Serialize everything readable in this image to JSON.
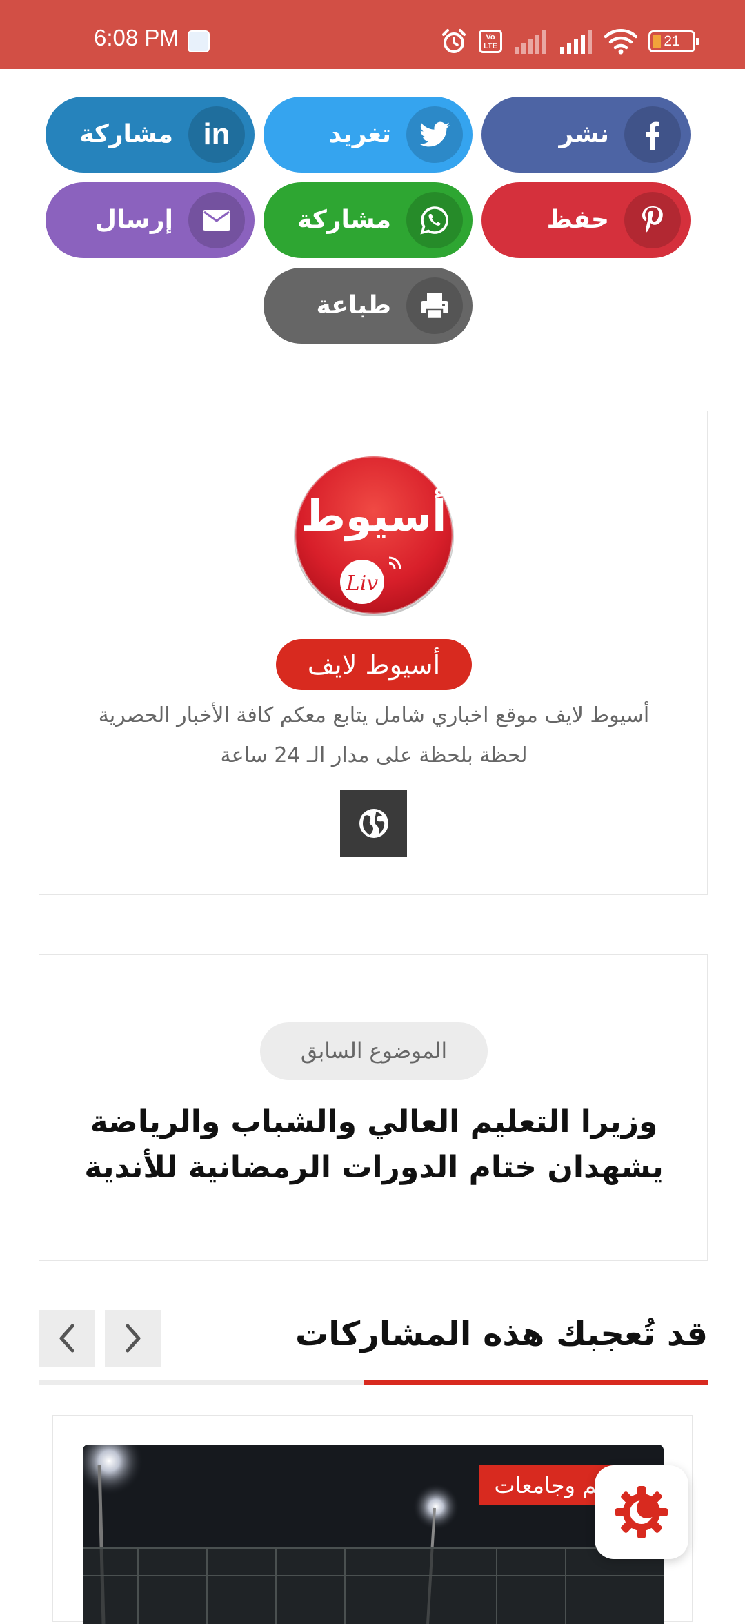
{
  "status_bar": {
    "time": "6:08 PM",
    "volte_label": "Vo LTE",
    "battery": "21"
  },
  "share": {
    "facebook": {
      "label": "نشر",
      "color": "#4d64a4"
    },
    "twitter": {
      "label": "تغريد",
      "color": "#35a4ef"
    },
    "linkedin": {
      "label": "مشاركة",
      "color": "#2683bc"
    },
    "pinterest": {
      "label": "حفظ",
      "color": "#d5303c"
    },
    "whatsapp": {
      "label": "مشاركة",
      "color": "#2ea632"
    },
    "email": {
      "label": "إرسال",
      "color": "#8b62be"
    },
    "print": {
      "label": "طباعة",
      "color": "#666666"
    }
  },
  "author": {
    "logo_text": "أسيوط",
    "logo_sub": "Liv",
    "name": "أسيوط لايف",
    "description": "أسيوط لايف موقع اخباري شامل يتابع معكم كافة الأخبار الحصرية لحظة بلحظة على مدار الـ 24 ساعة"
  },
  "prev_post": {
    "label": "الموضوع السابق",
    "title": "وزيرا التعليم العالي والشباب والرياضة يشهدان ختام الدورات الرمضانية للأندية"
  },
  "related": {
    "title": "قد تُعجبك هذه المشاركات",
    "category_tag": "تعليم وجامعات"
  },
  "colors": {
    "accent_red": "#d82a1f",
    "status_bar": "#d24f45"
  }
}
